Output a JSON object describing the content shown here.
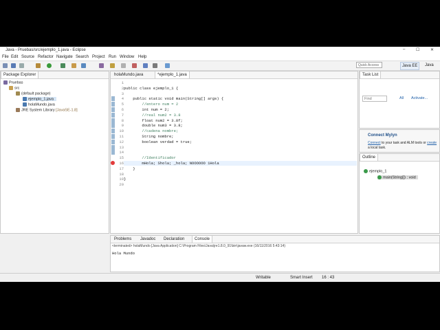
{
  "window": {
    "title": "Java - Pruebas/src/ejemplo_1.java - Eclipse",
    "min": "–",
    "max": "☐",
    "close": "✕"
  },
  "menu": [
    "File",
    "Edit",
    "Source",
    "Refactor",
    "Navigate",
    "Search",
    "Project",
    "Run",
    "Window",
    "Help"
  ],
  "toolbar": {
    "quick_access": "Quick Access",
    "persp_java_ee": "Java EE",
    "persp_java": "Java"
  },
  "package_explorer": {
    "title": "Package Explorer",
    "project": "Pruebas",
    "src": "src",
    "default_package": "(default package)",
    "file1": "ejemplo_1.java",
    "file2": "holaMundo.java",
    "jre": "JRE System Library",
    "jre_version": "[JavaSE-1.8]"
  },
  "editor": {
    "tab1": "holaMundo.java",
    "tab2": "*ejemplo_1.java",
    "lines": [
      {
        "n": "1",
        "t": ""
      },
      {
        "n": "2",
        "t": "public class ejemplo_1 {"
      },
      {
        "n": "3",
        "t": ""
      },
      {
        "n": "4",
        "t": "    public static void main(String[] args) {"
      },
      {
        "n": "5",
        "t": "        //entero num = 2"
      },
      {
        "n": "6",
        "t": "        int num = 2;"
      },
      {
        "n": "7",
        "t": "        //real num2 = 3.8"
      },
      {
        "n": "8",
        "t": "        float num2 = 3.8f;"
      },
      {
        "n": "9",
        "t": "        double num3 = 3.8;"
      },
      {
        "n": "10",
        "t": "        //cadena nombre;"
      },
      {
        "n": "11",
        "t": "        String nombre;"
      },
      {
        "n": "12",
        "t": "        boolean verdad = true;"
      },
      {
        "n": "13",
        "t": ""
      },
      {
        "n": "14",
        "t": ""
      },
      {
        "n": "15",
        "t": "        //Identificador"
      },
      {
        "n": "16",
        "t": "        mHola; Shola; _hola; NOOOOOO 1Hola"
      },
      {
        "n": "17",
        "t": "    }"
      },
      {
        "n": "18",
        "t": ""
      },
      {
        "n": "19",
        "t": "}"
      },
      {
        "n": "20",
        "t": ""
      }
    ]
  },
  "task_list": {
    "title": "Task List",
    "find_placeholder": "Find",
    "all": "All",
    "activate": "Activate..."
  },
  "mylyn": {
    "title": "Connect Mylyn",
    "link1": "Connect",
    "text1": " to your task and ALM tools or ",
    "link2": "create",
    "text2": " a local task."
  },
  "outline": {
    "title": "Outline",
    "class": "ejemplo_1",
    "method": "main(String[]) : void"
  },
  "console": {
    "tabs": [
      "Problems",
      "Javadoc",
      "Declaration",
      "Console"
    ],
    "header": "<terminated> holaMundo [Java Application] C:\\Program Files\\Java\\jre1.8.0_91\\bin\\javaw.exe (16/11/2016 5:43:14)",
    "output": "Hola Mundo"
  },
  "status": {
    "writable": "Writable",
    "insert": "Smart Insert",
    "position": "16 : 43"
  },
  "colors": {
    "keyword": "#7f0055",
    "comment": "#3f7f5f",
    "link": "#1f5fa8",
    "error": "#e23b3b"
  }
}
